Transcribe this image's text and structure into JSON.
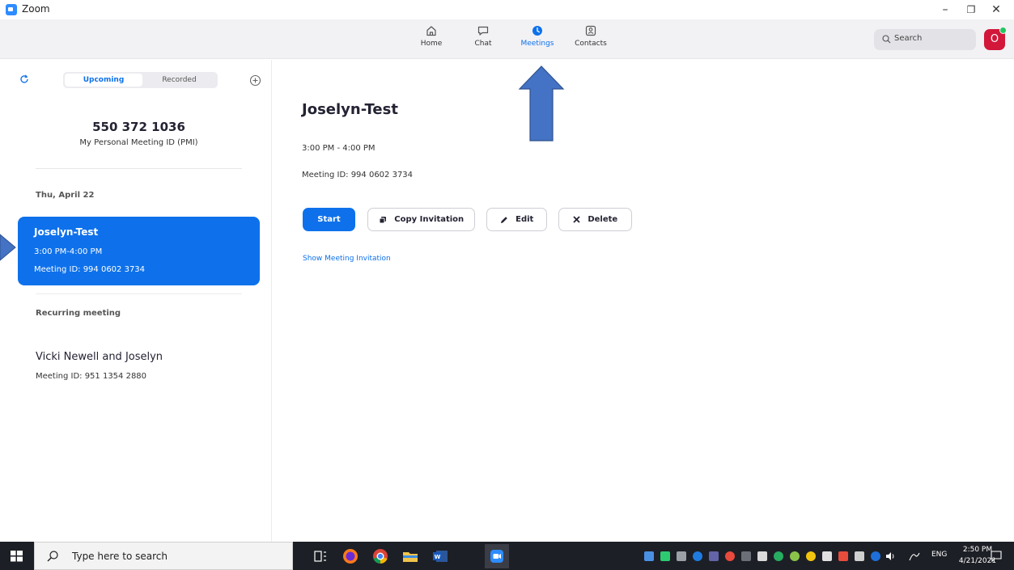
{
  "window": {
    "title": "Zoom",
    "minimize": "–",
    "restore": "❐",
    "close": "✕"
  },
  "nav": {
    "items": [
      {
        "label": "Home",
        "icon": "home-icon"
      },
      {
        "label": "Chat",
        "icon": "chat-icon"
      },
      {
        "label": "Meetings",
        "icon": "clock-icon",
        "active": true
      },
      {
        "label": "Contacts",
        "icon": "contacts-icon"
      }
    ],
    "search_label": "Search",
    "avatar_initial": "O"
  },
  "sidebar": {
    "tabs": [
      "Upcoming",
      "Recorded"
    ],
    "active_tab": "Upcoming",
    "pmi_number": "550 372 1036",
    "pmi_label": "My Personal Meeting ID (PMI)",
    "date_header": "Thu, April 22",
    "selected_meeting": {
      "title": "Joselyn-Test",
      "time": "3:00 PM-4:00 PM",
      "meeting_id": "Meeting ID: 994 0602 3734"
    },
    "recurring_header": "Recurring meeting",
    "recurring_meeting": {
      "title": "Vicki Newell and Joselyn",
      "meeting_id": "Meeting ID: 951 1354 2880"
    }
  },
  "detail": {
    "title": "Joselyn-Test",
    "time": "3:00 PM - 4:00 PM",
    "meeting_id": "Meeting ID: 994 0602 3734",
    "buttons": {
      "start": "Start",
      "copy": "Copy Invitation",
      "edit": "Edit",
      "delete": "Delete"
    },
    "show_invitation": "Show Meeting Invitation"
  },
  "taskbar": {
    "search_placeholder": "Type here to search",
    "language": "ENG",
    "time": "2:50 PM",
    "date": "4/21/2021"
  },
  "colors": {
    "accent": "#0e71eb",
    "annotation_arrow": "#4472c4",
    "avatar": "#d2173a"
  }
}
